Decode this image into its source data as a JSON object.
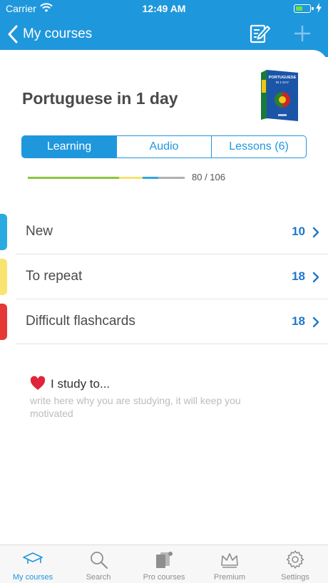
{
  "status_bar": {
    "carrier": "Carrier",
    "time": "12:49 AM",
    "battery_fill": 0.5,
    "icons": [
      "wifi-icon",
      "battery-icon",
      "bolt-icon"
    ]
  },
  "nav": {
    "back_label": "My courses",
    "back_icon": "chevron-left-icon",
    "edit_icon": "edit-note-icon",
    "add_icon": "plus-icon"
  },
  "course": {
    "title": "Portuguese in 1 day",
    "cover_text_line1": "PORTUGUESE",
    "cover_text_line2": "IN 1 DAY"
  },
  "tabs": [
    {
      "label": "Learning",
      "active": true
    },
    {
      "label": "Audio",
      "active": false
    },
    {
      "label": "Lessons (6)",
      "active": false
    }
  ],
  "progress": {
    "text": "80 / 106",
    "segments": [
      {
        "color": "#8cc63f",
        "fraction": 0.58
      },
      {
        "color": "#f7e26b",
        "fraction": 0.15
      },
      {
        "color": "#2ea7e0",
        "fraction": 0.1
      },
      {
        "color": "#b0b0b0",
        "fraction": 0.17
      }
    ]
  },
  "list": [
    {
      "label": "New",
      "count": "10",
      "color": "#29abe2"
    },
    {
      "label": "To repeat",
      "count": "18",
      "color": "#f9e46f"
    },
    {
      "label": "Difficult flashcards",
      "count": "18",
      "color": "#e53935"
    }
  ],
  "study": {
    "icon": "heart-icon",
    "title": "I study to...",
    "hint": "write here why you are studying, it will keep you motivated"
  },
  "tabbar": [
    {
      "label": "My courses",
      "icon": "graduation-cap-icon",
      "active": true
    },
    {
      "label": "Search",
      "icon": "search-icon",
      "active": false
    },
    {
      "label": "Pro courses",
      "icon": "cards-icon",
      "active": false
    },
    {
      "label": "Premium",
      "icon": "crown-icon",
      "active": false
    },
    {
      "label": "Settings",
      "icon": "gear-icon",
      "active": false
    }
  ],
  "colors": {
    "accent": "#1f97dc",
    "count_blue": "#1f78c8"
  }
}
